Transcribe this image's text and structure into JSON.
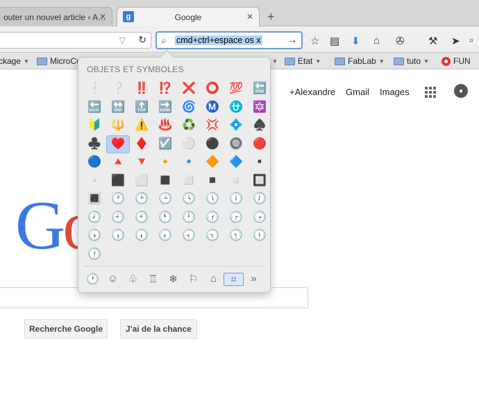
{
  "tabs": [
    {
      "label": "outer un nouvel article ‹ A…",
      "close": "✕"
    },
    {
      "label": "Google",
      "favicon": "g",
      "close": "✕"
    }
  ],
  "new_tab": "+",
  "search": {
    "icon": "⌕",
    "query": "cmd+ctrl+espace os x",
    "go": "→"
  },
  "nav_icons": {
    "star": "☆",
    "reading": "▤",
    "download": "⬇",
    "home": "⌂",
    "puzzle": "✇",
    "tools": "⚒",
    "send": "➤",
    "more": "▫"
  },
  "bookmarks": [
    {
      "label": "ckage",
      "folder": false
    },
    {
      "label": "MicroCo",
      "folder": true
    },
    {
      "label": "Etat",
      "folder": true
    },
    {
      "label": "FabLab",
      "folder": true
    },
    {
      "label": "tuto",
      "folder": true
    },
    {
      "label": "FUN",
      "folder": false
    }
  ],
  "google": {
    "links": [
      "+Alexandre",
      "Gmail",
      "Images"
    ],
    "logo_letters": [
      "G",
      "o"
    ],
    "buttons": [
      "Recherche Google",
      "J'ai de la chance"
    ]
  },
  "picker": {
    "title": "OBJETS ET SYMBOLES",
    "emoji": [
      "❕",
      "❔",
      "‼️",
      "⁉️",
      "❌",
      "⭕",
      "💯",
      "🔚",
      "🔙",
      "🔛",
      "🔝",
      "🔜",
      "🌀",
      "Ⓜ️",
      "⛎",
      "🔯",
      "🔰",
      "🔱",
      "⚠️",
      "♨️",
      "♻️",
      "💢",
      "💠",
      "♠️",
      "♣️",
      "♥️",
      "♦️",
      "☑️",
      "⚪",
      "⚫",
      "🔘",
      "🔴",
      "🔵",
      "🔺",
      "🔻",
      "🔸",
      "🔹",
      "🔶",
      "🔷",
      "▪️",
      "▫️",
      "⬛",
      "⬜",
      "◼️",
      "◻️",
      "◾",
      "◽",
      "🔲",
      "🔳",
      "🕐",
      "🕑",
      "🕒",
      "🕓",
      "🕔",
      "🕕",
      "🕖",
      "🕗",
      "🕘",
      "🕙",
      "🕚",
      "🕛",
      "🕜",
      "🕝",
      "🕞",
      "🕟",
      "🕠",
      "🕡",
      "🕢",
      "🕣",
      "🕤",
      "🕥",
      "🕦",
      "🕧"
    ],
    "selected_index": 25,
    "categories": [
      "🕐",
      "☺",
      "♧",
      "♖",
      "❄",
      "⚐",
      "⌂",
      "⌗",
      "»"
    ],
    "active_category": 7
  },
  "colors": {
    "accent": "#6a9bd8",
    "logo_blue": "#3b78e7",
    "logo_red": "#dd4b39"
  }
}
